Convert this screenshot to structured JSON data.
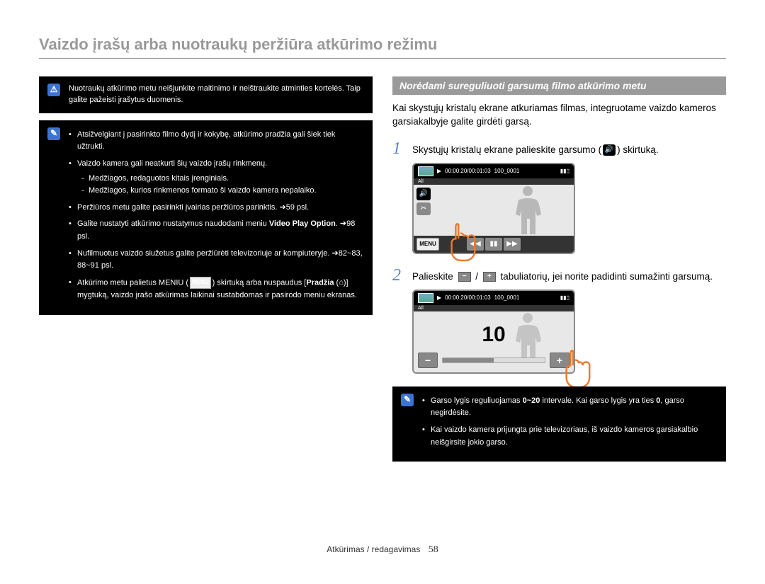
{
  "title": "Vaizdo įrašų arba nuotraukų peržiūra atkūrimo režimu",
  "left": {
    "warn": "Nuotraukų atkūrimo metu neišjunkite maitinimo ir neištraukite atminties kortelės. Taip galite pažeisti įrašytus duomenis.",
    "notes": {
      "n1": "Atsižvelgiant į pasirinkto filmo dydį ir kokybę, atkūrimo pradžia gali šiek tiek užtrukti.",
      "n2": "Vaizdo kamera gali neatkurti šių vaizdo įrašų rinkmenų.",
      "n2a": "Medžiagos, redaguotos kitais įrenginiais.",
      "n2b": "Medžiagos, kurios rinkmenos formato ši vaizdo kamera nepalaiko.",
      "n3": "Peržiūros metu galite pasirinkti įvairias peržiūros parinktis. ➔59 psl.",
      "n4_a": "Galite nustatyti atkūrimo nustatymus naudodami meniu ",
      "n4_b": "Video Play Option",
      "n4_c": ". ➔98 psl.",
      "n5": "Nufilmuotus vaizdo siužetus galite peržiūrėti televizoriuje ar kompiuteryje. ➔82~83, 88~91  psl.",
      "n6_a": "Atkūrimo metu palietus MENIU (",
      "n6_b": ") skirtuką arba nuspaudus [",
      "n6_c": "Pradžia",
      "n6_d": " (",
      "n6_e": ")] mygtuką, vaizdo įrašo atkūrimas laikinai sustabdomas ir pasirodo meniu ekranas.",
      "menu_label": "MENU",
      "home_glyph": "⌂"
    }
  },
  "right": {
    "heading": "Norėdami sureguliuoti garsumą filmo atkūrimo metu",
    "intro": "Kai skystųjų kristalų ekrane atkuriamas filmas, integruotame vaizdo kameros garsiakalbyje galite girdėti garsą.",
    "step1_a": "Skystųjų kristalų ekrane palieskite garsumo (",
    "step1_b": ") skirtuką.",
    "step2_a": "Palieskite ",
    "step2_b": " / ",
    "step2_c": " tabuliatorių, jei norite padidinti sumažinti garsumą.",
    "lcd": {
      "time": "00:00:20/00:01:03",
      "counter": "100_0001",
      "all": "All",
      "menu": "MENU",
      "rw": "◀◀",
      "pause": "▮▮",
      "ff": "▶▶",
      "vol_value": "10",
      "minus": "−",
      "plus": "+",
      "speaker": "🔊",
      "play": "▶",
      "bat": "▮▮▯"
    },
    "notes2": {
      "n1_a": "Garso lygis reguliuojamas ",
      "n1_b": "0~20",
      "n1_c": " intervale. Kai garso lygis yra ties ",
      "n1_d": "0",
      "n1_e": ", garso negirdėsite.",
      "n2": "Kai vaizdo kamera prijungta prie televizoriaus, iš vaizdo kameros garsiakalbio neišgirsite jokio garso."
    }
  },
  "footer": {
    "section": "Atkūrimas / redagavimas",
    "page": "58"
  }
}
